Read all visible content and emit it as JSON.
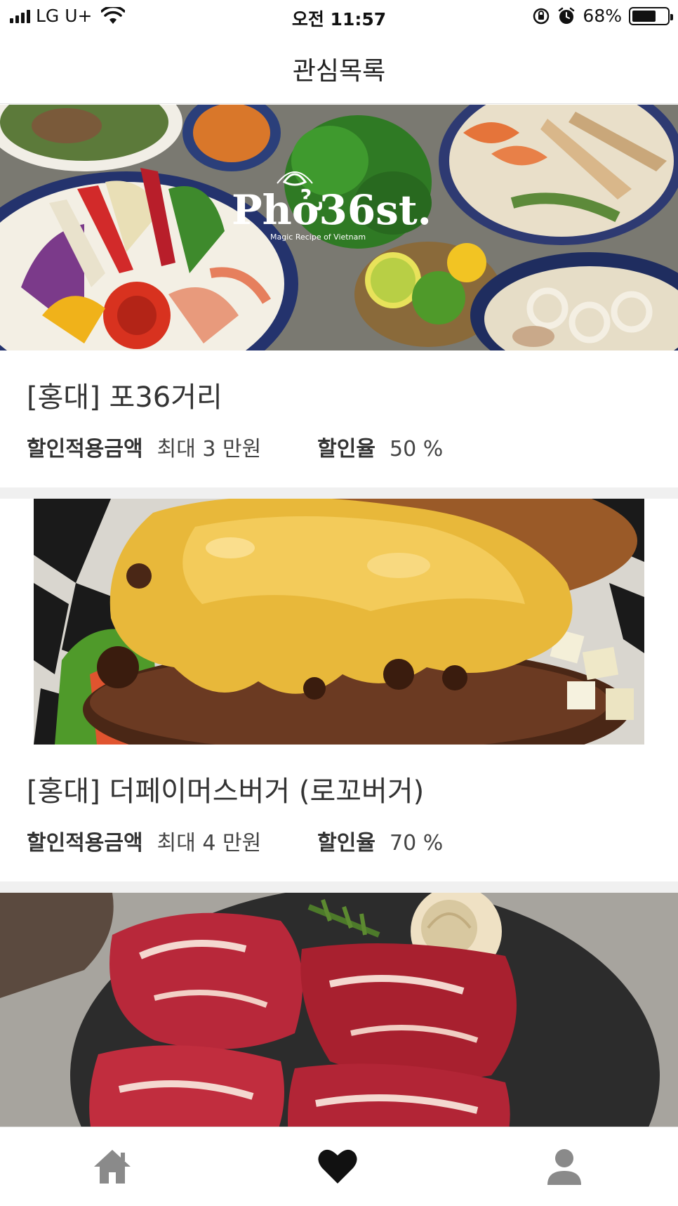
{
  "status_bar": {
    "carrier": "LG U+",
    "time": "오전 11:57",
    "battery_percent": "68%",
    "battery_level": 0.68,
    "icons": [
      "signal-icon",
      "wifi-icon",
      "rotation-lock-icon",
      "alarm-icon",
      "battery-icon"
    ]
  },
  "header": {
    "title": "관심목록"
  },
  "list": {
    "items": [
      {
        "name": "[홍대] 포36거리",
        "photo_logo": "Phở36st.",
        "photo_tagline": "Magic Recipe of Vietnam",
        "discount_amount_label": "할인적용금액",
        "discount_amount_value": "최대 3 만원",
        "discount_rate_label": "할인율",
        "discount_rate_value": "50 %"
      },
      {
        "name": "[홍대] 더페이머스버거 (로꼬버거)",
        "discount_amount_label": "할인적용금액",
        "discount_amount_value": "최대 4 만원",
        "discount_rate_label": "할인율",
        "discount_rate_value": "70 %"
      },
      {
        "name": "",
        "photo_only": true
      }
    ]
  },
  "tab_bar": {
    "tabs": [
      {
        "icon": "home-icon",
        "active": false
      },
      {
        "icon": "heart-icon",
        "active": true
      },
      {
        "icon": "person-icon",
        "active": false
      }
    ]
  },
  "colors": {
    "active_tab": "#111111",
    "inactive_tab": "#8a8a8a",
    "separator": "#f0f0f0"
  }
}
